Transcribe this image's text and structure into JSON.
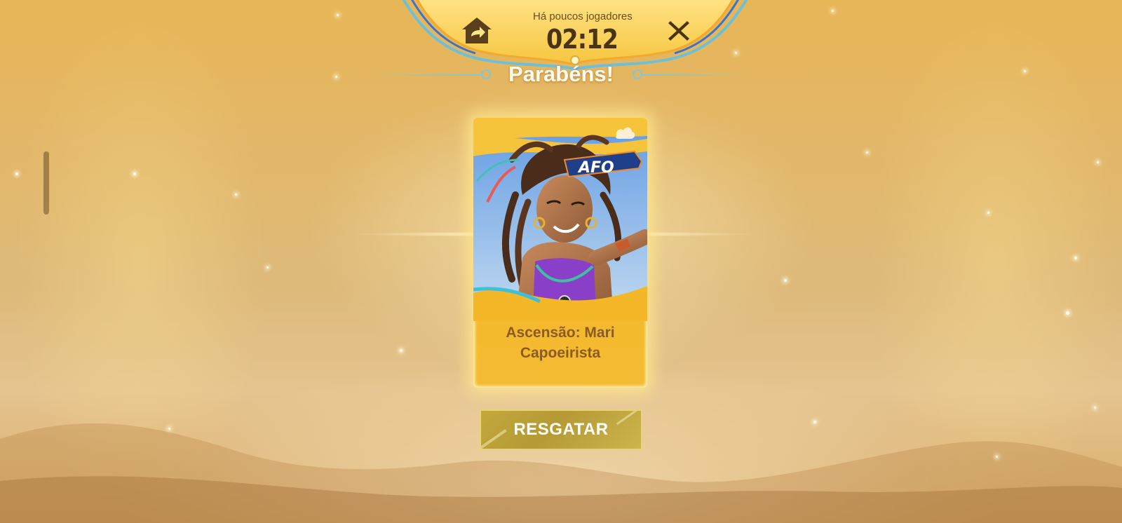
{
  "header": {
    "notice_text": "Há poucos jogadores",
    "timer": "02:12",
    "home_icon": "home-return-icon",
    "close_icon": "close-icon"
  },
  "title": "Parabéns!",
  "reward": {
    "name_line1": "Ascensão: Mari",
    "name_line2": "Capoeirista",
    "logo_text": "AFO"
  },
  "claim_button": {
    "label": "RESGATAR"
  },
  "colors": {
    "background": "#e2b76a",
    "card": "#f3b727",
    "card_text": "#8a5b25",
    "button": "#b59a35",
    "accent_line": "#7ec8dc"
  }
}
